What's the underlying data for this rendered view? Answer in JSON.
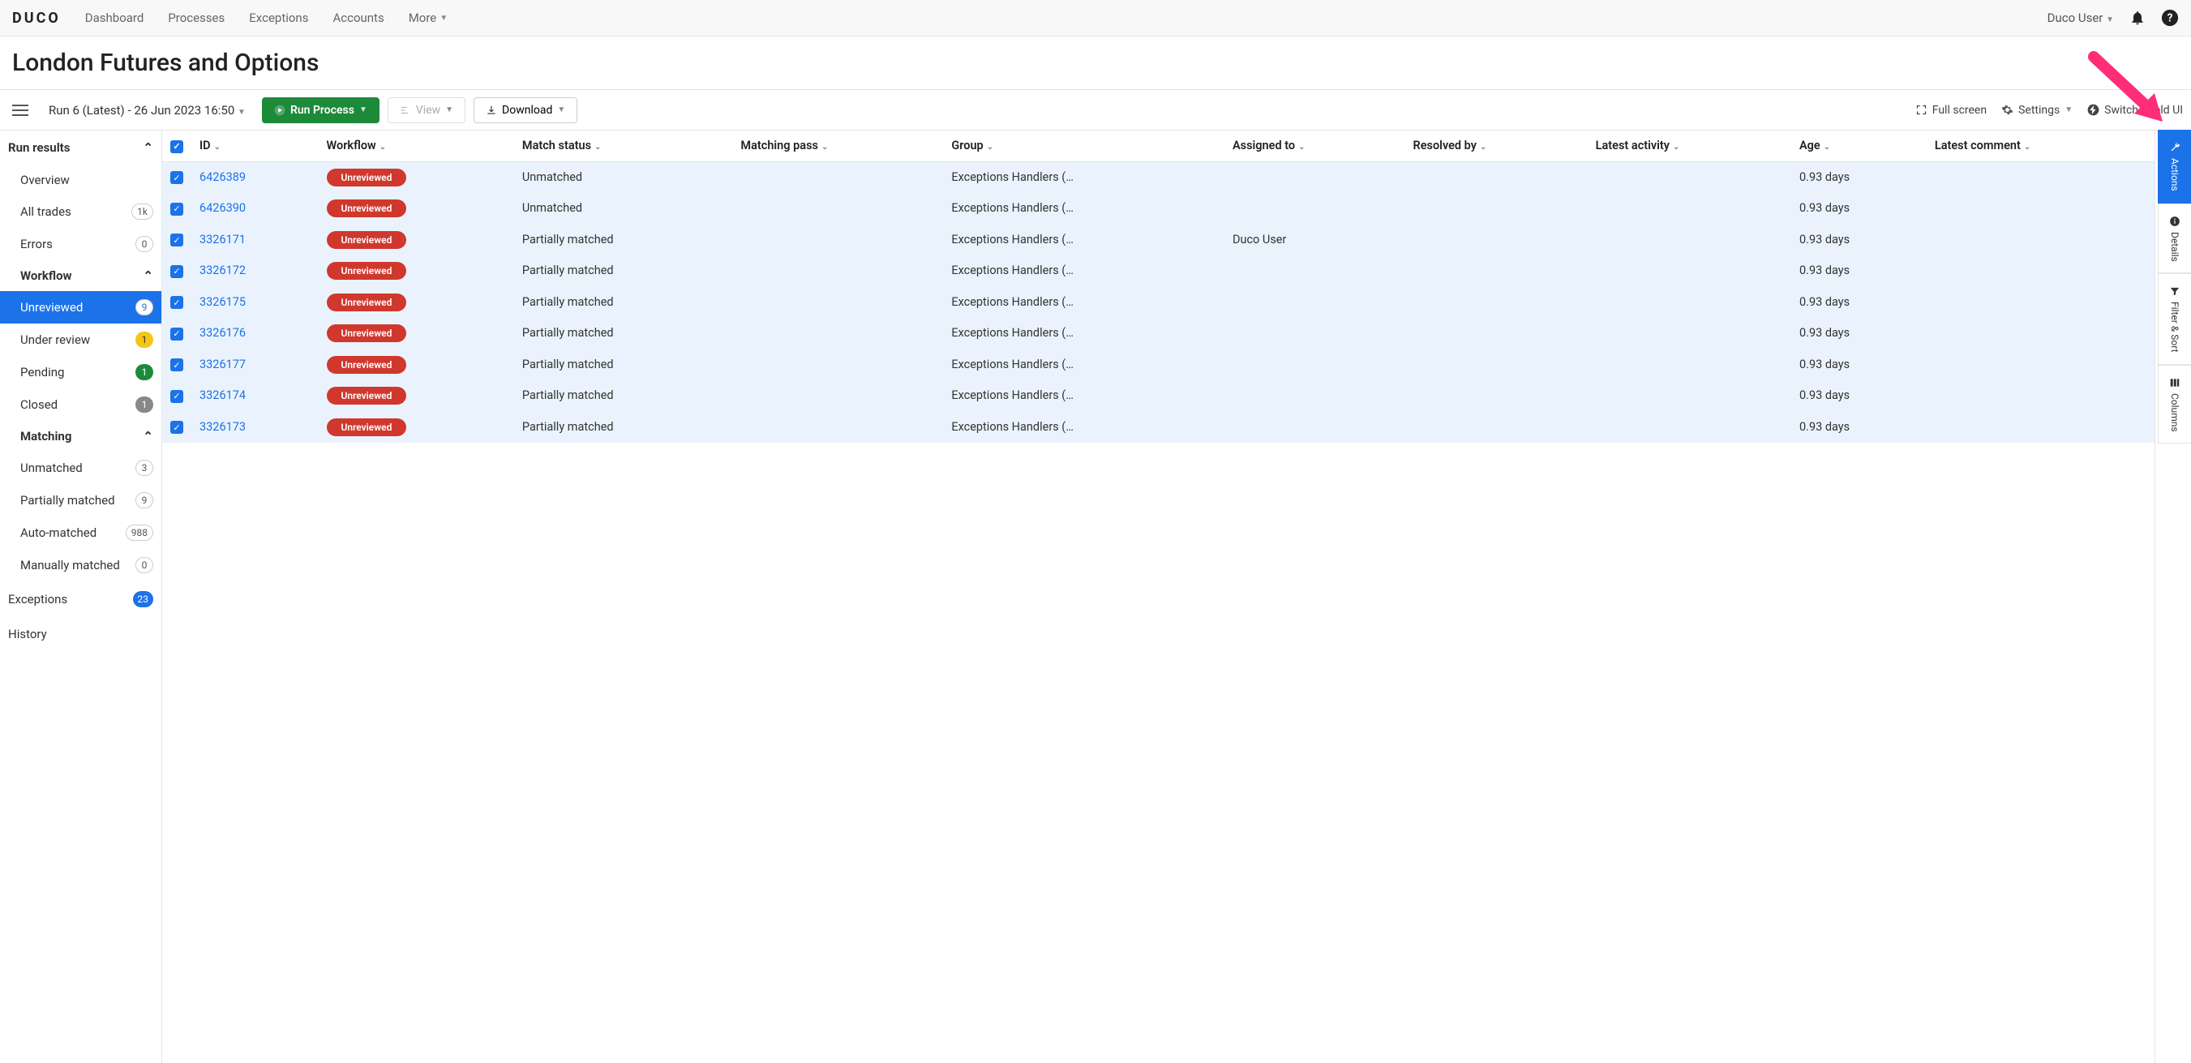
{
  "nav": {
    "logo": "DUCO",
    "links": [
      "Dashboard",
      "Processes",
      "Exceptions",
      "Accounts",
      "More"
    ],
    "user": "Duco User"
  },
  "page": {
    "title": "London Futures and Options"
  },
  "toolbar": {
    "run_selector": "Run 6 (Latest) - 26 Jun 2023 16:50",
    "run_process": "Run Process",
    "view": "View",
    "download": "Download",
    "fullscreen": "Full screen",
    "settings": "Settings",
    "switch": "Switch to old UI"
  },
  "sidebar": {
    "run_results": "Run results",
    "items_top": [
      {
        "label": "Overview"
      },
      {
        "label": "All trades",
        "count": "1k"
      },
      {
        "label": "Errors",
        "count": "0"
      }
    ],
    "workflow_header": "Workflow",
    "workflow_items": [
      {
        "label": "Unreviewed",
        "count": "9",
        "active": true
      },
      {
        "label": "Under review",
        "count": "1",
        "badge_class": "yellow"
      },
      {
        "label": "Pending",
        "count": "1",
        "badge_class": "green"
      },
      {
        "label": "Closed",
        "count": "1",
        "badge_class": "gray"
      }
    ],
    "matching_header": "Matching",
    "matching_items": [
      {
        "label": "Unmatched",
        "count": "3"
      },
      {
        "label": "Partially matched",
        "count": "9"
      },
      {
        "label": "Auto-matched",
        "count": "988"
      },
      {
        "label": "Manually matched",
        "count": "0"
      }
    ],
    "exceptions": {
      "label": "Exceptions",
      "count": "23"
    },
    "history": "History"
  },
  "table": {
    "columns": [
      "ID",
      "Workflow",
      "Match status",
      "Matching pass",
      "Group",
      "Assigned to",
      "Resolved by",
      "Latest activity",
      "Age",
      "Latest comment"
    ],
    "rows": [
      {
        "id": "6426389",
        "workflow": "Unreviewed",
        "match_status": "Unmatched",
        "group": "Exceptions Handlers (…",
        "assigned_to": "",
        "age": "0.93 days"
      },
      {
        "id": "6426390",
        "workflow": "Unreviewed",
        "match_status": "Unmatched",
        "group": "Exceptions Handlers (…",
        "assigned_to": "",
        "age": "0.93 days"
      },
      {
        "id": "3326171",
        "workflow": "Unreviewed",
        "match_status": "Partially matched",
        "group": "Exceptions Handlers (…",
        "assigned_to": "Duco User",
        "age": "0.93 days"
      },
      {
        "id": "3326172",
        "workflow": "Unreviewed",
        "match_status": "Partially matched",
        "group": "Exceptions Handlers (…",
        "assigned_to": "",
        "age": "0.93 days"
      },
      {
        "id": "3326175",
        "workflow": "Unreviewed",
        "match_status": "Partially matched",
        "group": "Exceptions Handlers (…",
        "assigned_to": "",
        "age": "0.93 days"
      },
      {
        "id": "3326176",
        "workflow": "Unreviewed",
        "match_status": "Partially matched",
        "group": "Exceptions Handlers (…",
        "assigned_to": "",
        "age": "0.93 days"
      },
      {
        "id": "3326177",
        "workflow": "Unreviewed",
        "match_status": "Partially matched",
        "group": "Exceptions Handlers (…",
        "assigned_to": "",
        "age": "0.93 days"
      },
      {
        "id": "3326174",
        "workflow": "Unreviewed",
        "match_status": "Partially matched",
        "group": "Exceptions Handlers (…",
        "assigned_to": "",
        "age": "0.93 days"
      },
      {
        "id": "3326173",
        "workflow": "Unreviewed",
        "match_status": "Partially matched",
        "group": "Exceptions Handlers (…",
        "assigned_to": "",
        "age": "0.93 days"
      }
    ]
  },
  "rail": {
    "actions": "Actions",
    "details": "Details",
    "filter": "Filter & Sort",
    "columns": "Columns"
  }
}
